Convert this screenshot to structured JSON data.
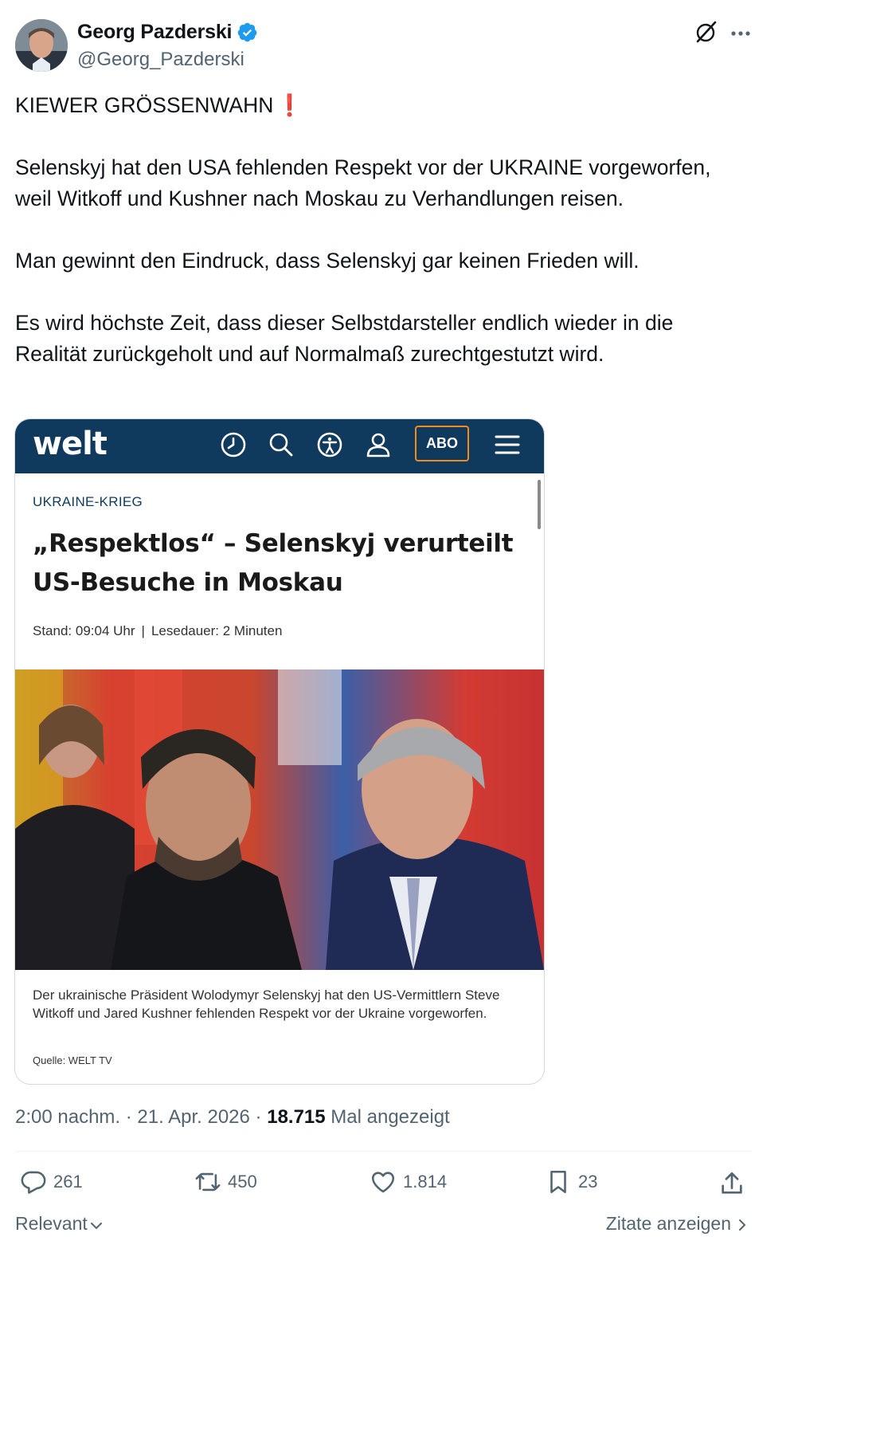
{
  "author": {
    "name": "Georg Pazderski",
    "handle": "@Georg_Pazderski"
  },
  "tweet": {
    "paragraphs": [
      "KIEWER GRÖSSENWAHN",
      "Selenskyj hat den USA fehlenden Respekt vor der UKRAINE vorgeworfen, weil Witkoff und Kushner nach Moskau zu Verhandlungen reisen.",
      "Man gewinnt den Eindruck, dass Selenskyj gar keinen Frieden will.",
      "Es wird höchste Zeit, dass dieser Selbstdarsteller endlich wieder in die Realität zurückgeholt und auf Normalmaß zurechtgestutzt wird."
    ],
    "emoji": "❗"
  },
  "article": {
    "logo": "welt",
    "abo": "ABO",
    "kicker": "UKRAINE-KRIEG",
    "headline": "„Respektlos“ – Selenskyj verurteilt US-Besuche in Moskau",
    "stand": "Stand: 09:04 Uhr",
    "lesedauer": "Lesedauer: 2 Minuten",
    "caption": "Der ukrainische Präsident Wolodymyr Selenskyj hat den US-Vermittlern Steve Witkoff und Jared Kushner fehlenden Respekt vor der Ukraine vorgeworfen.",
    "credit": "Quelle: WELT TV"
  },
  "meta": {
    "time": "2:00 nachm.",
    "date": "21. Apr. 2026",
    "views_count": "18.715",
    "views_label": "Mal angezeigt"
  },
  "actions": {
    "replies": "261",
    "reposts": "450",
    "likes": "1.814",
    "bookmarks": "23"
  },
  "footer": {
    "sort_label": "Relevant",
    "quotes_label": "Zitate anzeigen"
  },
  "colors": {
    "accent": "#1d9bf0",
    "muted": "#536471",
    "welt_navy": "#0f3a5e",
    "welt_orange": "#f28b1e"
  }
}
